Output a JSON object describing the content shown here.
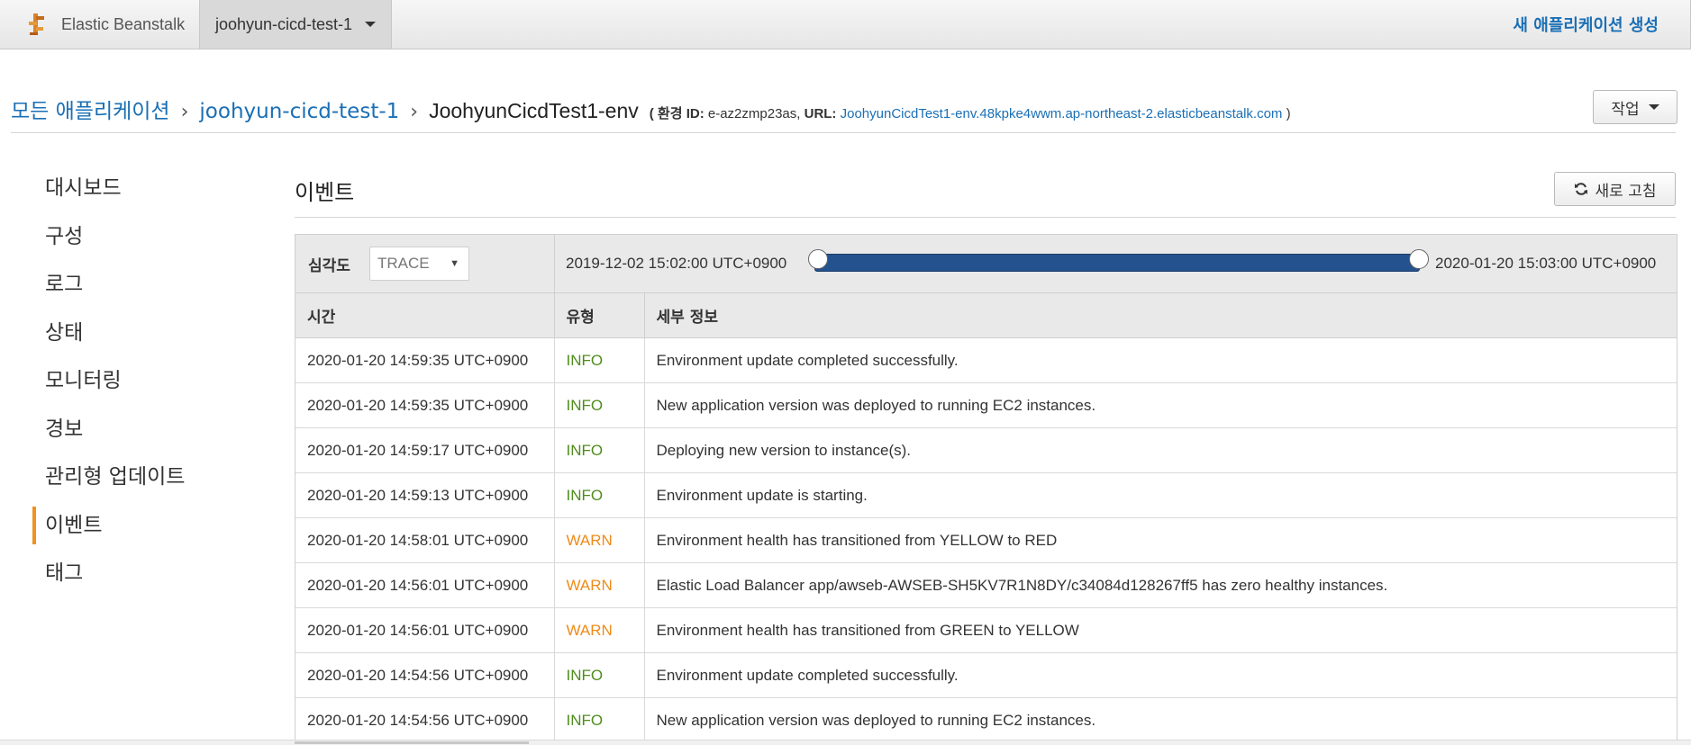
{
  "topbar": {
    "brand": "Elastic Beanstalk",
    "app_selector": "joohyun-cicd-test-1",
    "create_app": "새 애플리케이션 생성"
  },
  "breadcrumb": {
    "all_apps": "모든 애플리케이션",
    "app": "joohyun-cicd-test-1",
    "env": "JoohyunCicdTest1-env",
    "meta_open": "( 환경 ID:",
    "env_id": "e-az2zmp23as,",
    "url_label": "URL:",
    "url": "JoohyunCicdTest1-env.48kpke4wwm.ap-northeast-2.elasticbeanstalk.com",
    "meta_close": ")"
  },
  "actions_button": "작업",
  "sidebar": {
    "items": [
      {
        "label": "대시보드"
      },
      {
        "label": "구성"
      },
      {
        "label": "로그"
      },
      {
        "label": "상태"
      },
      {
        "label": "모니터링"
      },
      {
        "label": "경보"
      },
      {
        "label": "관리형 업데이트"
      },
      {
        "label": "이벤트"
      },
      {
        "label": "태그"
      }
    ],
    "active": "이벤트"
  },
  "events": {
    "title": "이벤트",
    "refresh": "새로 고침",
    "severity_label": "심각도",
    "severity_value": "TRACE",
    "range_start": "2019-12-02 15:02:00 UTC+0900",
    "range_end": "2020-01-20 15:03:00 UTC+0900",
    "columns": [
      "시간",
      "유형",
      "세부 정보"
    ],
    "rows": [
      {
        "time": "2020-01-20 14:59:35 UTC+0900",
        "type": "INFO",
        "details": "Environment update completed successfully."
      },
      {
        "time": "2020-01-20 14:59:35 UTC+0900",
        "type": "INFO",
        "details": "New application version was deployed to running EC2 instances."
      },
      {
        "time": "2020-01-20 14:59:17 UTC+0900",
        "type": "INFO",
        "details": "Deploying new version to instance(s)."
      },
      {
        "time": "2020-01-20 14:59:13 UTC+0900",
        "type": "INFO",
        "details": "Environment update is starting."
      },
      {
        "time": "2020-01-20 14:58:01 UTC+0900",
        "type": "WARN",
        "details": "Environment health has transitioned from YELLOW to RED"
      },
      {
        "time": "2020-01-20 14:56:01 UTC+0900",
        "type": "WARN",
        "details": "Elastic Load Balancer app/awseb-AWSEB-SH5KV7R1N8DY/c34084d128267ff5 has zero healthy instances."
      },
      {
        "time": "2020-01-20 14:56:01 UTC+0900",
        "type": "WARN",
        "details": "Environment health has transitioned from GREEN to YELLOW"
      },
      {
        "time": "2020-01-20 14:54:56 UTC+0900",
        "type": "INFO",
        "details": "Environment update completed successfully."
      },
      {
        "time": "2020-01-20 14:54:56 UTC+0900",
        "type": "INFO",
        "details": "New application version was deployed to running EC2 instances."
      }
    ]
  },
  "colors": {
    "link": "#1a6fb5",
    "info": "#4f8c1c",
    "warn": "#ee8b1a",
    "active_marker": "#f0921f",
    "slider": "#24528e"
  },
  "icons": {
    "brand_logo": "beanstalk-logo-icon",
    "dropdown": "caret-down-icon",
    "refresh": "refresh-icon"
  }
}
